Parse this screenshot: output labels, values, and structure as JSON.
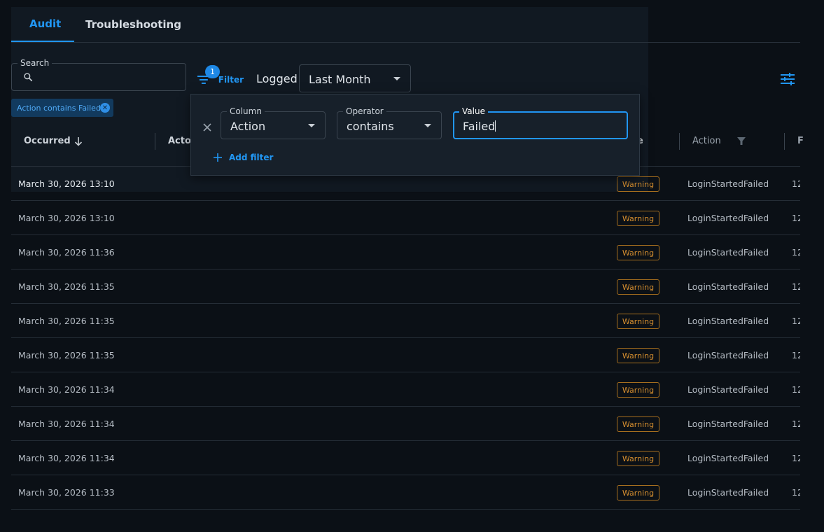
{
  "tabs": [
    {
      "label": "Audit",
      "active": true
    },
    {
      "label": "Troubleshooting",
      "active": false
    }
  ],
  "toolbar": {
    "search_label": "Search",
    "search_value": "",
    "filter_label": "Filter",
    "filter_count": "1",
    "logged_label": "Logged",
    "logged_value": "Last Month"
  },
  "active_filter_chip": "Action contains Failed",
  "columns": {
    "occurred": "Occurred",
    "actor": "Actor",
    "level_partial": "e",
    "action": "Action",
    "last_partial": "F"
  },
  "filter_popup": {
    "column_label": "Column",
    "column_value": "Action",
    "operator_label": "Operator",
    "operator_value": "contains",
    "value_label": "Value",
    "value_value": "Failed",
    "add_filter_label": "Add filter"
  },
  "rows": [
    {
      "occurred": "March 30, 2026 13:10",
      "level": "Warning",
      "action": "LoginStartedFailed",
      "extra": "12"
    },
    {
      "occurred": "March 30, 2026 13:10",
      "level": "Warning",
      "action": "LoginStartedFailed",
      "extra": "12"
    },
    {
      "occurred": "March 30, 2026 11:36",
      "level": "Warning",
      "action": "LoginStartedFailed",
      "extra": "12"
    },
    {
      "occurred": "March 30, 2026 11:35",
      "level": "Warning",
      "action": "LoginStartedFailed",
      "extra": "12"
    },
    {
      "occurred": "March 30, 2026 11:35",
      "level": "Warning",
      "action": "LoginStartedFailed",
      "extra": "12"
    },
    {
      "occurred": "March 30, 2026 11:35",
      "level": "Warning",
      "action": "LoginStartedFailed",
      "extra": "12"
    },
    {
      "occurred": "March 30, 2026 11:34",
      "level": "Warning",
      "action": "LoginStartedFailed",
      "extra": "12"
    },
    {
      "occurred": "March 30, 2026 11:34",
      "level": "Warning",
      "action": "LoginStartedFailed",
      "extra": "12"
    },
    {
      "occurred": "March 30, 2026 11:34",
      "level": "Warning",
      "action": "LoginStartedFailed",
      "extra": "12"
    },
    {
      "occurred": "March 30, 2026 11:33",
      "level": "Warning",
      "action": "LoginStartedFailed",
      "extra": "12"
    }
  ],
  "colors": {
    "accent": "#2196f3",
    "warning": "#d38d2f",
    "background": "#0b1016"
  }
}
